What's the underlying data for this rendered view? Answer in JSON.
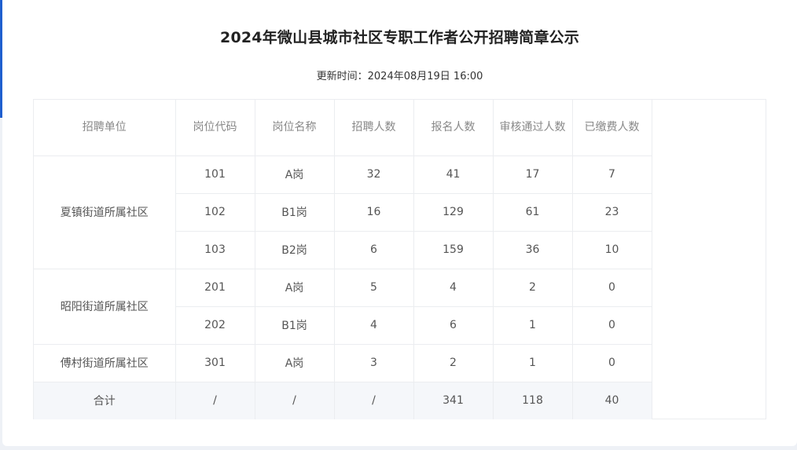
{
  "title": "2024年微山县城市社区专职工作者公开招聘简章公示",
  "update": {
    "label": "更新时间：",
    "value": "2024年08月19日 16:00"
  },
  "table": {
    "headers": [
      "招聘单位",
      "岗位代码",
      "岗位名称",
      "招聘人数",
      "报名人数",
      "审核通过人数",
      "已缴费人数"
    ],
    "units": [
      {
        "name": "夏镇街道所属社区",
        "rows": [
          {
            "code": "101",
            "post": "A岗",
            "quota": "32",
            "applied": "41",
            "approved": "17",
            "paid": "7"
          },
          {
            "code": "102",
            "post": "B1岗",
            "quota": "16",
            "applied": "129",
            "approved": "61",
            "paid": "23"
          },
          {
            "code": "103",
            "post": "B2岗",
            "quota": "6",
            "applied": "159",
            "approved": "36",
            "paid": "10"
          }
        ]
      },
      {
        "name": "昭阳街道所属社区",
        "rows": [
          {
            "code": "201",
            "post": "A岗",
            "quota": "5",
            "applied": "4",
            "approved": "2",
            "paid": "0"
          },
          {
            "code": "202",
            "post": "B1岗",
            "quota": "4",
            "applied": "6",
            "approved": "1",
            "paid": "0"
          }
        ]
      },
      {
        "name": "傅村街道所属社区",
        "rows": [
          {
            "code": "301",
            "post": "A岗",
            "quota": "3",
            "applied": "2",
            "approved": "1",
            "paid": "0"
          }
        ]
      }
    ],
    "total": {
      "label": "合计",
      "code": "/",
      "post": "/",
      "quota": "/",
      "applied": "341",
      "approved": "118",
      "paid": "40"
    }
  }
}
